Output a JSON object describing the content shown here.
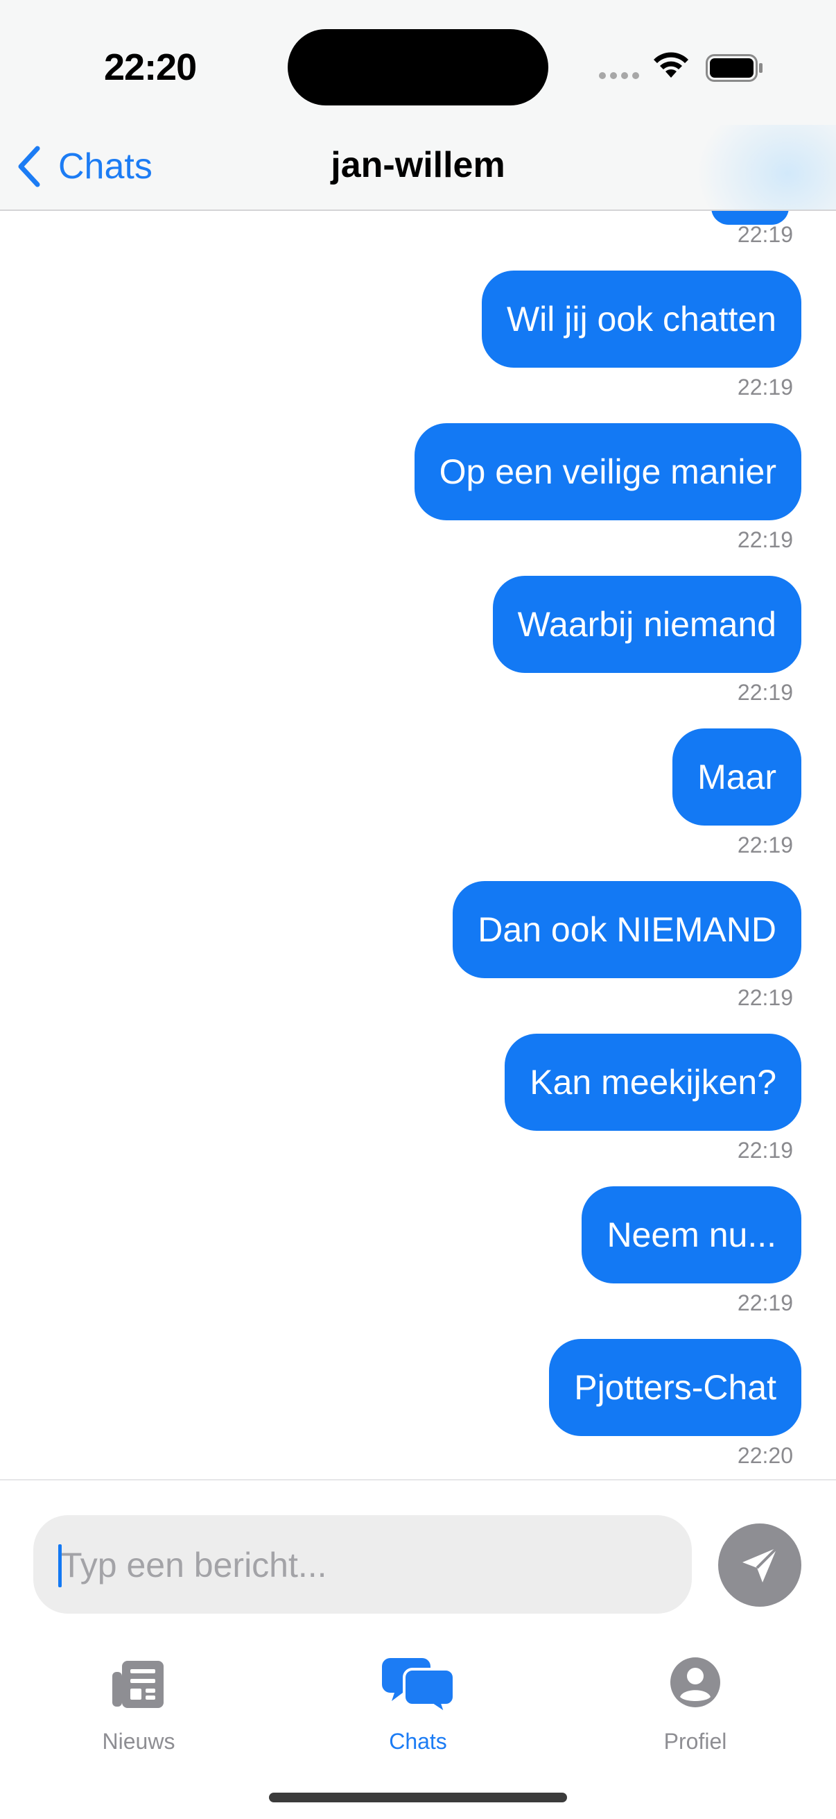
{
  "status_bar": {
    "time": "22:20"
  },
  "nav": {
    "back_label": "Chats",
    "title": "jan-willem"
  },
  "messages": [
    {
      "text": "Wil jij ook chatten",
      "time": "22:19"
    },
    {
      "text": "Op een veilige manier",
      "time": "22:19"
    },
    {
      "text": "Waarbij niemand",
      "time": "22:19"
    },
    {
      "text": "Maar",
      "time": "22:19"
    },
    {
      "text": "Dan ook NIEMAND",
      "time": "22:19"
    },
    {
      "text": "Kan meekijken?",
      "time": "22:19"
    },
    {
      "text": "Neem nu...",
      "time": "22:19"
    },
    {
      "text": "Pjotters-Chat",
      "time": "22:20"
    }
  ],
  "top_partial_message": {
    "time": "22:19"
  },
  "composer": {
    "placeholder": "Typ een bericht...",
    "value": ""
  },
  "tabs": [
    {
      "label": "Nieuws",
      "icon": "newspaper-icon",
      "active": false
    },
    {
      "label": "Chats",
      "icon": "chat-bubbles-icon",
      "active": true
    },
    {
      "label": "Profiel",
      "icon": "person-circle-icon",
      "active": false
    }
  ],
  "colors": {
    "accent": "#1379f4",
    "tab_active": "#1c7cf4",
    "tab_inactive": "#8e8e93",
    "bubble_text": "#ffffff",
    "timestamp": "#8a8a8e",
    "send_button": "#8e8e93"
  }
}
